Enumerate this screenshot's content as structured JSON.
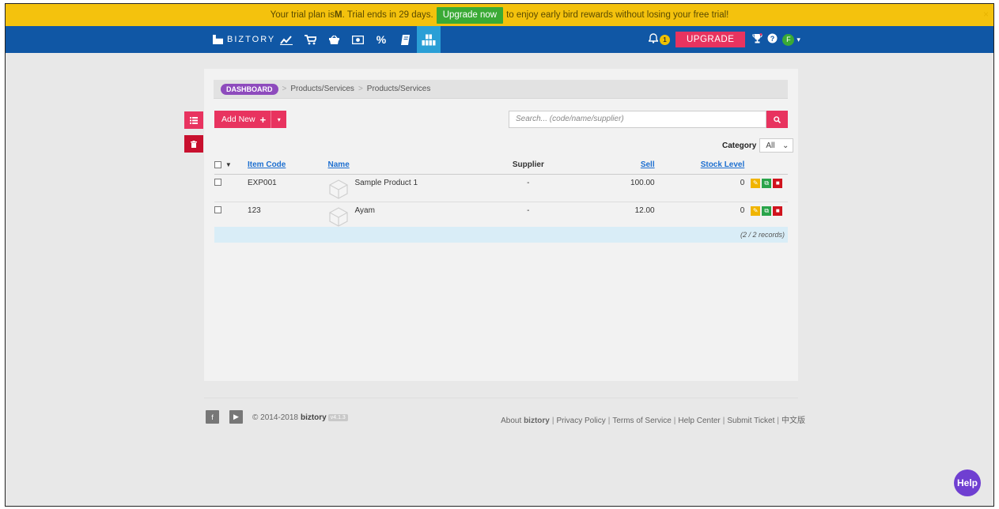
{
  "trial_banner": {
    "text_before": "Your trial plan is ",
    "plan": "M",
    "text_mid": ". Trial ends in 29 days.",
    "upgrade_now": "Upgrade now",
    "text_after": "to enjoy early bird rewards without losing your free trial!",
    "close": "×"
  },
  "nav": {
    "brand": "BIZTORY",
    "icons": [
      "chart-line-icon",
      "cart-icon",
      "basket-icon",
      "money-icon",
      "percent-icon",
      "book-icon",
      "boxes-icon"
    ],
    "notification_count": "1",
    "upgrade_label": "UPGRADE",
    "avatar_initial": "F"
  },
  "breadcrumb": {
    "home": "DASHBOARD",
    "items": [
      "Products/Services",
      "Products/Services"
    ]
  },
  "toolbar": {
    "add_new_label": "Add New",
    "search_placeholder": "Search... (code/name/supplier)"
  },
  "filter": {
    "category_label": "Category",
    "category_value": "All"
  },
  "table": {
    "headers": {
      "item_code": "Item Code",
      "name": "Name",
      "supplier": "Supplier",
      "sell": "Sell",
      "stock_level": "Stock Level"
    },
    "rows": [
      {
        "item_code": "EXP001",
        "name": "Sample Product 1",
        "supplier": "-",
        "sell": "100.00",
        "stock": "0"
      },
      {
        "item_code": "123",
        "name": "Ayam",
        "supplier": "-",
        "sell": "12.00",
        "stock": "0"
      }
    ],
    "records": "(2 / 2 records)"
  },
  "footer": {
    "copyright": "© 2014-2018",
    "brand": "biztory",
    "version": "v4.1.3",
    "links": {
      "about_prefix": "About ",
      "about_brand": "biztory",
      "privacy": "Privacy Policy",
      "terms": "Terms of Service",
      "help_center": "Help Center",
      "submit_ticket": "Submit Ticket",
      "chinese": "中文版"
    }
  },
  "help_button": "Help",
  "colors": {
    "banner": "#f4c20d",
    "nav": "#1057a5",
    "accent": "#e8335f",
    "dashboard_pill": "#8e4bbd",
    "help": "#6f3fd1"
  }
}
